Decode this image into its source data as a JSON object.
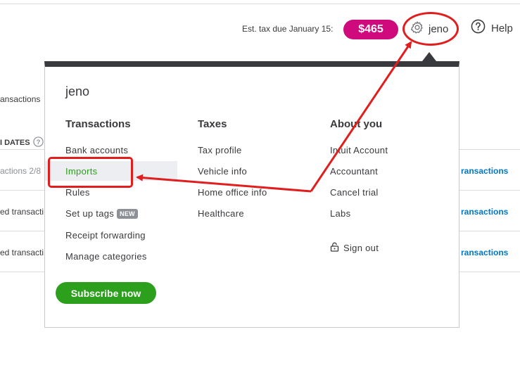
{
  "header": {
    "est_tax_label": "Est. tax due January 15:",
    "tax_amount": "$465",
    "user_name": "jeno",
    "help_label": "Help"
  },
  "background": {
    "transactions_text": "ansactions",
    "dates_header": "I DATES",
    "rows": [
      {
        "left_text": "actions 2/8",
        "right_link": "ransactions"
      },
      {
        "left_text": "ed transacti",
        "right_link": "ransactions"
      },
      {
        "left_text": "ed transacti",
        "right_link": "ransactions"
      }
    ]
  },
  "menu": {
    "user_name": "jeno",
    "columns": [
      {
        "heading": "Transactions",
        "items": [
          "Bank accounts",
          "Imports",
          "Rules",
          "Set up tags",
          "Receipt forwarding",
          "Manage categories"
        ]
      },
      {
        "heading": "Taxes",
        "items": [
          "Tax profile",
          "Vehicle info",
          "Home office info",
          "Healthcare"
        ]
      },
      {
        "heading": "About you",
        "items": [
          "Intuit Account",
          "Accountant",
          "Cancel trial",
          "Labs"
        ]
      }
    ],
    "new_badge": "NEW",
    "sign_out": "Sign out",
    "subscribe": "Subscribe now"
  },
  "colors": {
    "tax_pill": "#cf0a7c",
    "accent_green": "#2ca01c",
    "annotation_red": "#e01e1e",
    "link_blue": "#0077c5"
  }
}
